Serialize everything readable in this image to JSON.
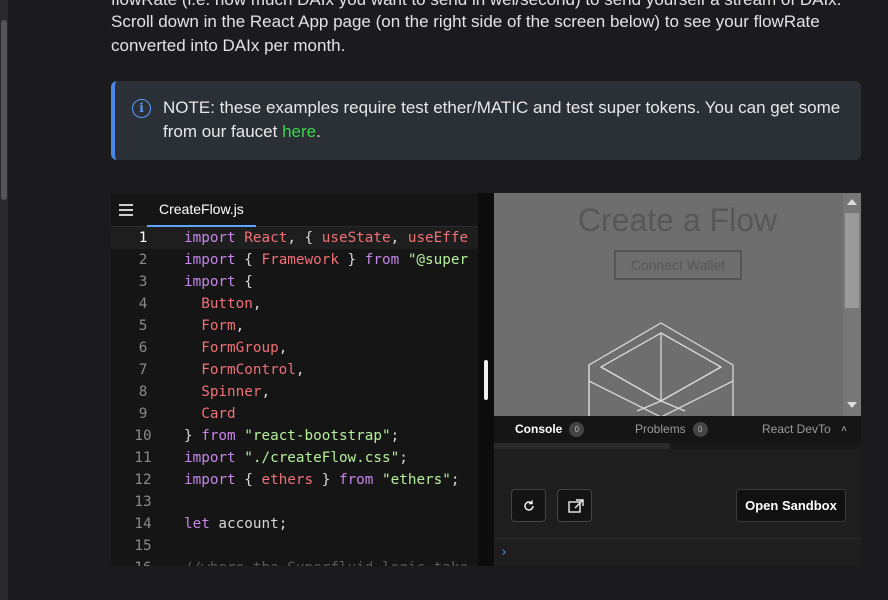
{
  "prose": {
    "line1_fragment": "flowRate (i.e. how much DAIx you want to send in wei/second) to send yourself a stream of DAIx.",
    "line2": "Scroll down in the React App page (on the right side of the screen below) to see your flowRate",
    "line3": "converted into DAIx per month."
  },
  "note": {
    "text": "NOTE: these examples require test ether/MATIC and test super tokens. You can get some from our faucet",
    "link_label": "here",
    "suffix": "."
  },
  "editor": {
    "tab_label": "CreateFlow.js",
    "line_numbers": [
      "1",
      "2",
      "3",
      "4",
      "5",
      "6",
      "7",
      "8",
      "9",
      "10",
      "11",
      "12",
      "13",
      "14",
      "15",
      "16"
    ],
    "lines": [
      [
        {
          "c": "kw",
          "t": "import"
        },
        {
          "c": "",
          "t": " "
        },
        {
          "c": "id",
          "t": "React"
        },
        {
          "c": "",
          "t": ", { "
        },
        {
          "c": "id",
          "t": "useState"
        },
        {
          "c": "",
          "t": ", "
        },
        {
          "c": "id",
          "t": "useEffe"
        }
      ],
      [
        {
          "c": "kw",
          "t": "import"
        },
        {
          "c": "",
          "t": " { "
        },
        {
          "c": "id",
          "t": "Framework"
        },
        {
          "c": "",
          "t": " } "
        },
        {
          "c": "kw",
          "t": "from"
        },
        {
          "c": "",
          "t": " "
        },
        {
          "c": "str",
          "t": "\"@super"
        }
      ],
      [
        {
          "c": "kw",
          "t": "import"
        },
        {
          "c": "",
          "t": " {"
        }
      ],
      [
        {
          "c": "",
          "t": "  "
        },
        {
          "c": "id",
          "t": "Button"
        },
        {
          "c": "",
          "t": ","
        }
      ],
      [
        {
          "c": "",
          "t": "  "
        },
        {
          "c": "id",
          "t": "Form"
        },
        {
          "c": "",
          "t": ","
        }
      ],
      [
        {
          "c": "",
          "t": "  "
        },
        {
          "c": "id",
          "t": "FormGroup"
        },
        {
          "c": "",
          "t": ","
        }
      ],
      [
        {
          "c": "",
          "t": "  "
        },
        {
          "c": "id",
          "t": "FormControl"
        },
        {
          "c": "",
          "t": ","
        }
      ],
      [
        {
          "c": "",
          "t": "  "
        },
        {
          "c": "id",
          "t": "Spinner"
        },
        {
          "c": "",
          "t": ","
        }
      ],
      [
        {
          "c": "",
          "t": "  "
        },
        {
          "c": "id",
          "t": "Card"
        }
      ],
      [
        {
          "c": "",
          "t": "} "
        },
        {
          "c": "kw",
          "t": "from"
        },
        {
          "c": "",
          "t": " "
        },
        {
          "c": "str",
          "t": "\"react-bootstrap\""
        },
        {
          "c": "",
          "t": ";"
        }
      ],
      [
        {
          "c": "kw",
          "t": "import"
        },
        {
          "c": "",
          "t": " "
        },
        {
          "c": "str",
          "t": "\"./createFlow.css\""
        },
        {
          "c": "",
          "t": ";"
        }
      ],
      [
        {
          "c": "kw",
          "t": "import"
        },
        {
          "c": "",
          "t": " { "
        },
        {
          "c": "id",
          "t": "ethers"
        },
        {
          "c": "",
          "t": " } "
        },
        {
          "c": "kw",
          "t": "from"
        },
        {
          "c": "",
          "t": " "
        },
        {
          "c": "str",
          "t": "\"ethers\""
        },
        {
          "c": "",
          "t": ";"
        }
      ],
      [],
      [
        {
          "c": "kw",
          "t": "let"
        },
        {
          "c": "",
          "t": " account;"
        }
      ],
      [],
      [
        {
          "c": "cm",
          "t": "//where the Superfluid logic take"
        }
      ]
    ]
  },
  "preview": {
    "title": "Create a Flow",
    "button_label": "Connect Wallet"
  },
  "devtools": {
    "tabs": [
      {
        "label": "Console",
        "count": "0"
      },
      {
        "label": "Problems",
        "count": "0"
      },
      {
        "label": "React DevTo"
      }
    ],
    "open_sandbox_label": "Open Sandbox",
    "prompt_symbol": "›"
  }
}
